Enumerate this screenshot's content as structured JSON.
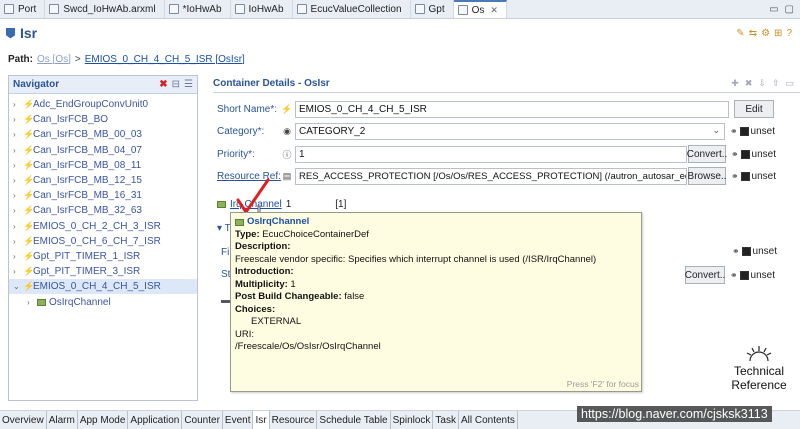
{
  "top_tabs": [
    {
      "label": "Port",
      "active": false,
      "icon": "config-icon"
    },
    {
      "label": "Swcd_IoHwAb.arxml",
      "active": false,
      "icon": "file-icon"
    },
    {
      "label": "*IoHwAb",
      "active": false,
      "icon": "config-icon"
    },
    {
      "label": "IoHwAb",
      "active": false,
      "icon": "config-icon"
    },
    {
      "label": "EcucValueCollection",
      "active": false,
      "icon": "config-icon"
    },
    {
      "label": "Gpt",
      "active": false,
      "icon": "config-icon"
    },
    {
      "label": "Os",
      "active": true,
      "icon": "config-icon"
    }
  ],
  "header": {
    "title": "Isr"
  },
  "path": {
    "label": "Path:",
    "parent": "Os [Os]",
    "separator": ">",
    "current": "EMIOS_0_CH_4_CH_5_ISR [OsIsr]"
  },
  "navigator": {
    "title": "Navigator",
    "items": [
      "Adc_EndGroupConvUnit0",
      "Can_IsrFCB_BO",
      "Can_IsrFCB_MB_00_03",
      "Can_IsrFCB_MB_04_07",
      "Can_IsrFCB_MB_08_11",
      "Can_IsrFCB_MB_12_15",
      "Can_IsrFCB_MB_16_31",
      "Can_IsrFCB_MB_32_63",
      "EMIOS_0_CH_2_CH_3_ISR",
      "EMIOS_0_CH_6_CH_7_ISR",
      "Gpt_PIT_TIMER_1_ISR",
      "Gpt_PIT_TIMER_3_ISR",
      "EMIOS_0_CH_4_CH_5_ISR"
    ],
    "selected_index": 12,
    "child": "OsIrqChannel"
  },
  "details": {
    "title": "Container Details - OsIsr",
    "short_name": {
      "label": "Short Name*:",
      "value": "EMIOS_0_CH_4_CH_5_ISR",
      "button": "Edit"
    },
    "category": {
      "label": "Category*:",
      "value": "CATEGORY_2",
      "unset": "unset"
    },
    "priority": {
      "label": "Priority*:",
      "value": "1",
      "button": "Convert..",
      "unset": "unset"
    },
    "resource": {
      "label": "Resource Ref:",
      "value": "RES_ACCESS_PROTECTION [/Os/Os/RES_ACCESS_PROTECTION] (/autron_autosar_edu_",
      "button": "Browse..",
      "unset": "unset"
    },
    "irq": {
      "label": "Irq Channel",
      "count": "1",
      "range": "[1]"
    },
    "bg_row1_unset": "unset",
    "bg_row2_button": "Convert..",
    "bg_row2_unset": "unset",
    "bg_label_f": "Fi",
    "bg_label_s": "St"
  },
  "tooltip": {
    "title": "OsIrqChannel",
    "type_label": "Type:",
    "type_value": "EcucChoiceContainerDef",
    "desc_label": "Description:",
    "desc_value": "Freescale vendor specific: Specifies which interrupt channel is used (/ISR/IrqChannel)",
    "intro_label": "Introduction:",
    "mult_label": "Multiplicity:",
    "mult_value": "1",
    "pbc_label": "Post Build Changeable:",
    "pbc_value": "false",
    "choices_label": "Choices:",
    "choices_value": "EXTERNAL",
    "uri_label": "URI:",
    "uri_value": "/Freescale/Os/OsIsr/OsIrqChannel",
    "footer": "Press 'F2' for focus"
  },
  "bottom_tabs": [
    "Overview",
    "Alarm",
    "App Mode",
    "Application",
    "Counter",
    "Event",
    "Isr",
    "Resource",
    "Schedule Table",
    "Spinlock",
    "Task",
    "All Contents"
  ],
  "bottom_active": "Isr",
  "watermark": {
    "line1": "Technical",
    "line2": "Reference",
    "url": "https://blog.naver.com/cjsksk3113"
  },
  "colors": {
    "accent": "#2a5496",
    "link": "#1b4fa8",
    "tooltip_bg": "#fffde1",
    "check": "#e02020"
  }
}
